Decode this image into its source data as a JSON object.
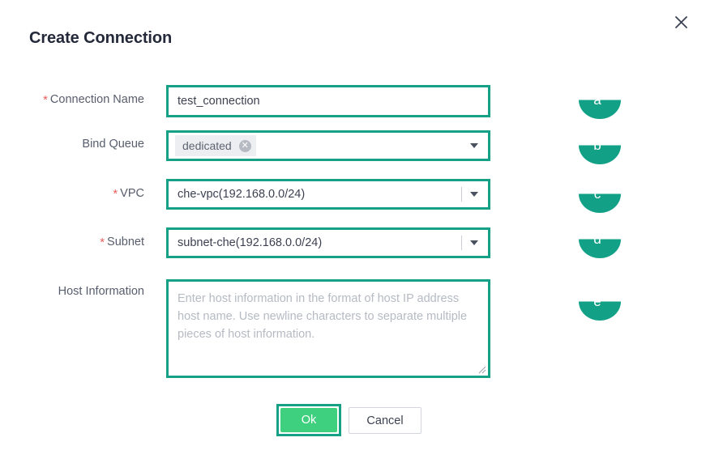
{
  "dialog": {
    "title": "Create Connection",
    "close_icon": "close-icon"
  },
  "accent_colors": {
    "highlight_teal": "#16a085",
    "ok_green": "#3ed07e",
    "required_red": "#e8615e",
    "callout_teal": "#16a085",
    "label_gray": "#575d6c",
    "title_navy": "#24293a",
    "placeholder_gray": "#b6bac3"
  },
  "fields": {
    "connection_name": {
      "label": "Connection Name",
      "required": true,
      "value": "test_connection",
      "placeholder": ""
    },
    "bind_queue": {
      "label": "Bind Queue",
      "required": false,
      "tags": [
        "dedicated"
      ],
      "remove_icon": "close-circle-icon",
      "caret_icon": "chevron-down-icon"
    },
    "vpc": {
      "label": "VPC",
      "required": true,
      "value": "che-vpc(192.168.0.0/24)",
      "caret_icon": "chevron-down-icon"
    },
    "subnet": {
      "label": "Subnet",
      "required": true,
      "value": "subnet-che(192.168.0.0/24)",
      "caret_icon": "chevron-down-icon"
    },
    "host_information": {
      "label": "Host Information",
      "required": false,
      "value": "",
      "placeholder": "Enter host information in the format of host IP address host name. Use newline characters to separate multiple pieces of host information."
    }
  },
  "footer": {
    "ok_label": "Ok",
    "cancel_label": "Cancel"
  },
  "callouts": [
    {
      "letter": "a",
      "target": "connection_name"
    },
    {
      "letter": "b",
      "target": "bind_queue"
    },
    {
      "letter": "c",
      "target": "vpc"
    },
    {
      "letter": "d",
      "target": "subnet"
    },
    {
      "letter": "e",
      "target": "host_information"
    }
  ],
  "required_marker": "*"
}
